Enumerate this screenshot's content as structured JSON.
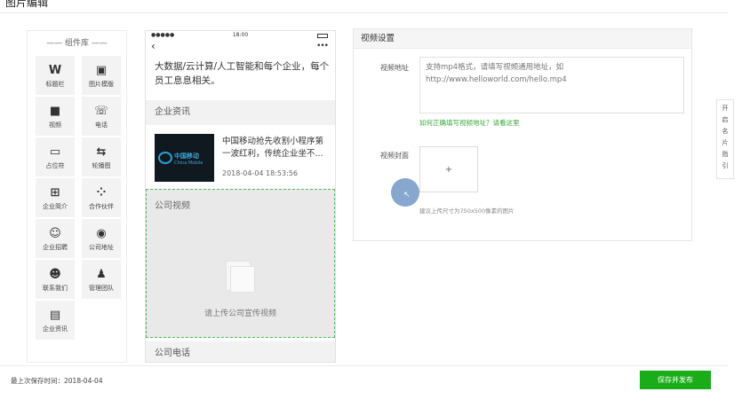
{
  "header": {
    "title": "图片编辑"
  },
  "library": {
    "title": "—— 组件库 ——",
    "items": [
      {
        "label": "标题栏",
        "icon": "title-bar-icon",
        "glyph": "W"
      },
      {
        "label": "图片模版",
        "icon": "image-template-icon",
        "glyph": "▣"
      },
      {
        "label": "视频",
        "icon": "video-camera-icon",
        "glyph": "■"
      },
      {
        "label": "电话",
        "icon": "phone-icon",
        "glyph": "☏"
      },
      {
        "label": "占位符",
        "icon": "placeholder-icon",
        "glyph": "▭"
      },
      {
        "label": "轮播图",
        "icon": "carousel-icon",
        "glyph": "⇆"
      },
      {
        "label": "企业简介",
        "icon": "company-intro-icon",
        "glyph": "⊞"
      },
      {
        "label": "合作伙伴",
        "icon": "partners-icon",
        "glyph": "⁘"
      },
      {
        "label": "企业招聘",
        "icon": "recruitment-icon",
        "glyph": "☺"
      },
      {
        "label": "公司地址",
        "icon": "location-pin-icon",
        "glyph": "◉"
      },
      {
        "label": "联系我们",
        "icon": "contact-icon",
        "glyph": "☻"
      },
      {
        "label": "管理团队",
        "icon": "team-icon",
        "glyph": "♟"
      },
      {
        "label": "企业资讯",
        "icon": "news-icon",
        "glyph": "▤"
      }
    ]
  },
  "phone": {
    "status": {
      "signal": "●●●●●",
      "time": "18:00"
    },
    "nav": {
      "back": "‹",
      "more": "•••"
    },
    "intro_text": "大数据/云计算/人工智能和每个企业，每个员工息息相关。",
    "sections": {
      "news_title": "企业资讯",
      "video_title": "公司视频",
      "phone_title": "公司电话"
    },
    "news": {
      "title": "中国移动抢先收割小程序第一波红利，传统企业坐不...",
      "date": "2018-04-04 18:53:56",
      "thumb_text": "中国移动",
      "thumb_sub": "China Mobile"
    },
    "video_hint": "请上传公司宣传视频"
  },
  "settings": {
    "title": "视频设置",
    "url_label": "视频地址",
    "url_placeholder": "支持mp4格式，请填写视频通用地址，如http://www.helloworld.com/hello.mp4",
    "help_link": "如何正确填写视频地址？请看这里",
    "cover_label": "视频封面",
    "upload_plus": "+",
    "upload_hint": "建议上传尺寸为750x500像素的图片"
  },
  "side_tab": {
    "chars": [
      "开",
      "启",
      "名",
      "片",
      "指",
      "引"
    ]
  },
  "footer": {
    "last_saved": "最上次保存时间：2018-04-04",
    "publish_label": "保存并发布"
  },
  "colors": {
    "accent": "#1aad19",
    "link": "#3ba83b",
    "dashed_border": "#55b955"
  }
}
